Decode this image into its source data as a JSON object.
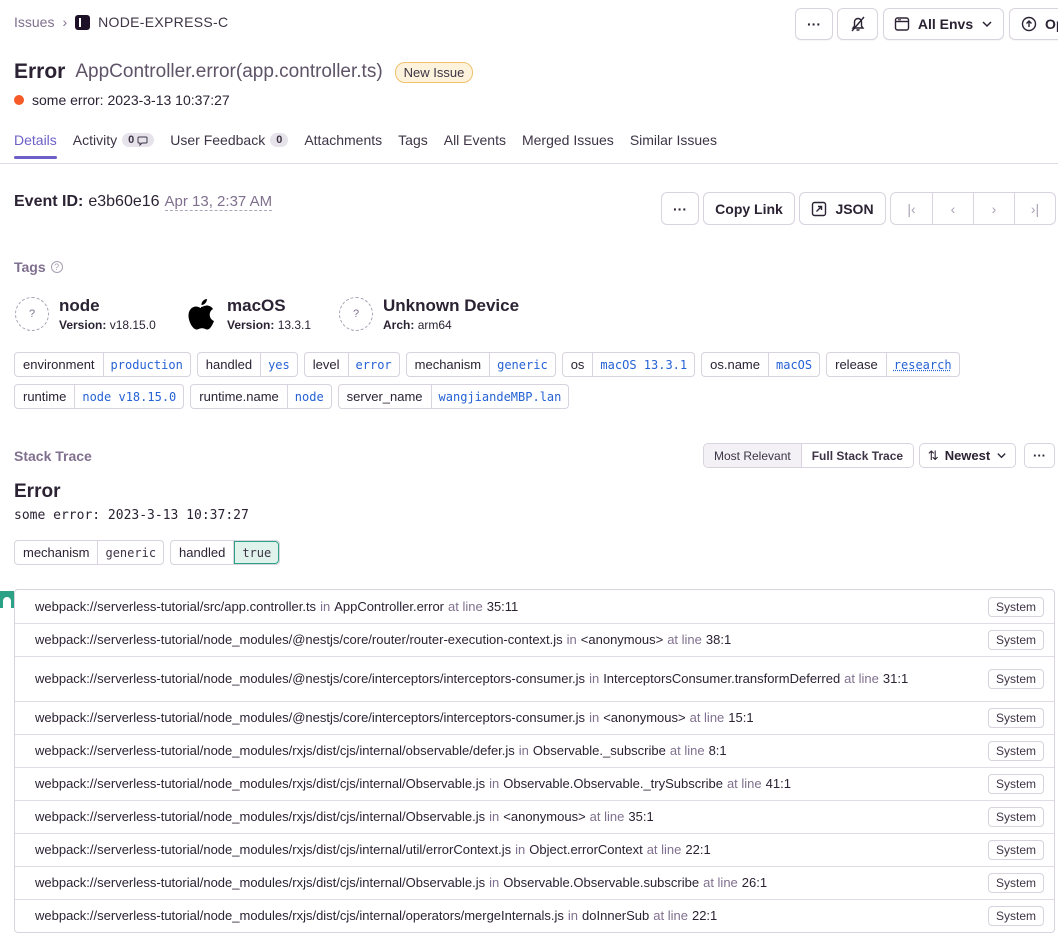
{
  "breadcrumb": {
    "root": "Issues",
    "project": "NODE-EXPRESS-C"
  },
  "header_actions": {
    "more": "···",
    "env": "All Envs",
    "open": "Op"
  },
  "issue": {
    "type": "Error",
    "culprit": "AppController.error(app.controller.ts)",
    "badge": "New Issue",
    "message": "some error: 2023-3-13 10:37:27",
    "status_color": "#f55a28"
  },
  "tabs": [
    {
      "label": "Details"
    },
    {
      "label": "Activity",
      "count": "0"
    },
    {
      "label": "User Feedback",
      "count": "0"
    },
    {
      "label": "Attachments"
    },
    {
      "label": "Tags"
    },
    {
      "label": "All Events"
    },
    {
      "label": "Merged Issues"
    },
    {
      "label": "Similar Issues"
    }
  ],
  "event": {
    "label": "Event ID:",
    "id": "e3b60e16",
    "date": "Apr 13, 2:37 AM",
    "more": "···",
    "copy_link": "Copy Link",
    "json": "JSON"
  },
  "tags_section": {
    "label": "Tags"
  },
  "contexts": [
    {
      "name": "node",
      "sub_key": "Version:",
      "sub_val": "v18.15.0",
      "icon": "unknown-icon"
    },
    {
      "name": "macOS",
      "sub_key": "Version:",
      "sub_val": "13.3.1",
      "icon": "apple-icon"
    },
    {
      "name": "Unknown Device",
      "sub_key": "Arch:",
      "sub_val": "arm64",
      "icon": "unknown-icon"
    }
  ],
  "tags_row1": [
    {
      "k": "environment",
      "v": "production"
    },
    {
      "k": "handled",
      "v": "yes"
    },
    {
      "k": "level",
      "v": "error"
    },
    {
      "k": "mechanism",
      "v": "generic"
    },
    {
      "k": "os",
      "v": "macOS 13.3.1"
    },
    {
      "k": "os.name",
      "v": "macOS"
    },
    {
      "k": "release",
      "v": "research"
    }
  ],
  "tags_row2": [
    {
      "k": "runtime",
      "v": "node v18.15.0"
    },
    {
      "k": "runtime.name",
      "v": "node"
    },
    {
      "k": "server_name",
      "v": "wangjiandeMBP.lan"
    }
  ],
  "stack": {
    "label": "Stack Trace",
    "most_relevant": "Most Relevant",
    "full": "Full Stack Trace",
    "sort": "Newest",
    "more": "···",
    "error_type": "Error",
    "error_message": "some error: 2023-3-13 10:37:27",
    "mech_tags": [
      {
        "k": "mechanism",
        "v": "generic"
      },
      {
        "k": "handled",
        "v": "true"
      }
    ],
    "in_word": "in",
    "at_line_word": "at line",
    "system_label": "System",
    "frames": [
      {
        "file": "webpack://serverless-tutorial/src/app.controller.ts",
        "fn": "AppController.error",
        "line": "35:11"
      },
      {
        "file": "webpack://serverless-tutorial/node_modules/@nestjs/core/router/router-execution-context.js",
        "fn": "<anonymous>",
        "line": "38:1"
      },
      {
        "file": "webpack://serverless-tutorial/node_modules/@nestjs/core/interceptors/interceptors-consumer.js",
        "fn": "InterceptorsConsumer.transformDeferred",
        "line": "31:1"
      },
      {
        "file": "webpack://serverless-tutorial/node_modules/@nestjs/core/interceptors/interceptors-consumer.js",
        "fn": "<anonymous>",
        "line": "15:1"
      },
      {
        "file": "webpack://serverless-tutorial/node_modules/rxjs/dist/cjs/internal/observable/defer.js",
        "fn": "Observable._subscribe",
        "line": "8:1"
      },
      {
        "file": "webpack://serverless-tutorial/node_modules/rxjs/dist/cjs/internal/Observable.js",
        "fn": "Observable.Observable._trySubscribe",
        "line": "41:1"
      },
      {
        "file": "webpack://serverless-tutorial/node_modules/rxjs/dist/cjs/internal/Observable.js",
        "fn": "<anonymous>",
        "line": "35:1"
      },
      {
        "file": "webpack://serverless-tutorial/node_modules/rxjs/dist/cjs/internal/util/errorContext.js",
        "fn": "Object.errorContext",
        "line": "22:1"
      },
      {
        "file": "webpack://serverless-tutorial/node_modules/rxjs/dist/cjs/internal/Observable.js",
        "fn": "Observable.Observable.subscribe",
        "line": "26:1"
      },
      {
        "file": "webpack://serverless-tutorial/node_modules/rxjs/dist/cjs/internal/operators/mergeInternals.js",
        "fn": "doInnerSub",
        "line": "22:1"
      }
    ]
  }
}
